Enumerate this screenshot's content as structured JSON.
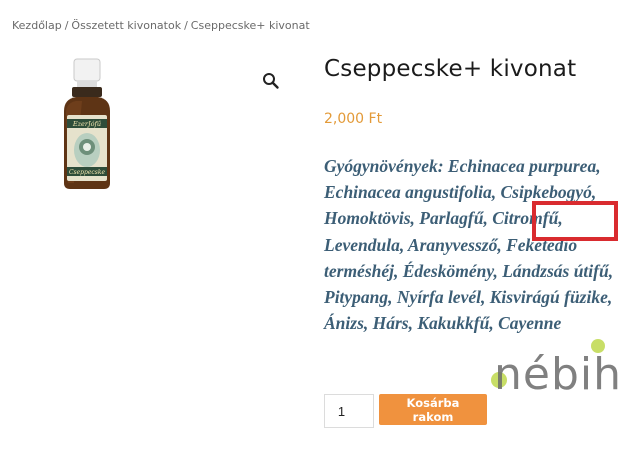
{
  "breadcrumb": {
    "home": "Kezdőlap",
    "category": "Összetett kivonatok",
    "current": "Cseppecske+ kivonat",
    "separator": "/"
  },
  "product": {
    "title": "Cseppecske+ kivonat",
    "price": "2,000 Ft",
    "description": "Gyógynövények: Echinacea purpurea, Echinacea angustifolia, Csipkebogyó, Homoktövis, Parlagfű, Citromfű, Levendula, Aranyvessző, Feketedió terméshéj, Édeskömény, Lándzsás útifű, Pitypang, Nyírfa levél, Kisvirágú füzike, Ánizs, Hárs, Kakukkfű, Cayenne",
    "highlighted_word": "Parlagfű"
  },
  "image": {
    "brand_label": "EzerJófű",
    "product_label": "Cseppecske"
  },
  "icons": {
    "zoom": "magnifier-icon"
  },
  "cart": {
    "quantity": "1",
    "button_label": "Kosárba rakom"
  },
  "watermark": {
    "text": "nébih"
  },
  "colors": {
    "price": "#e39a38",
    "description": "#3c5e76",
    "button": "#f0923e",
    "highlight": "#d92b2f",
    "watermark_green": "#b5d334"
  }
}
